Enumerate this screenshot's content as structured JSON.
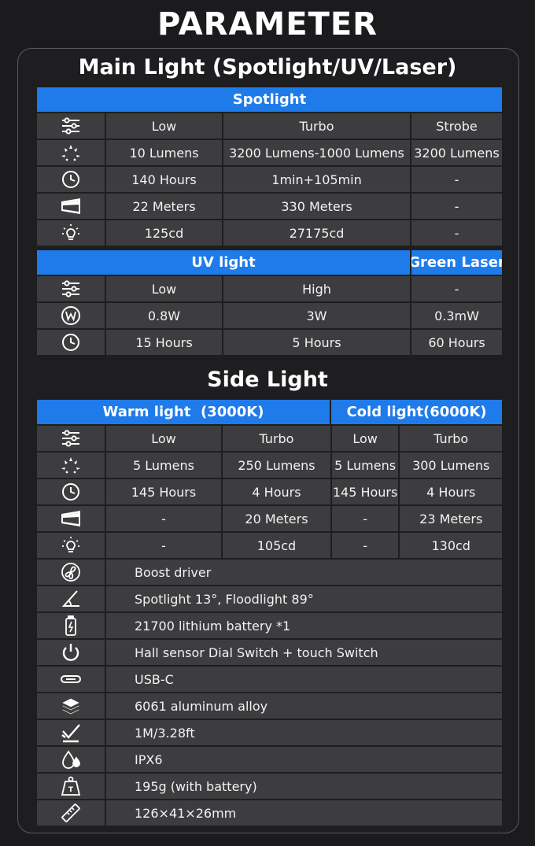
{
  "title": "PARAMETER",
  "main_light": {
    "title": "Main Light (Spotlight/UV/Laser)",
    "spotlight": {
      "header": "Spotlight",
      "rows": [
        {
          "icon": "mode-sliders-icon",
          "cells": [
            "Low",
            "Turbo",
            "Strobe"
          ]
        },
        {
          "icon": "brightness-icon",
          "cells": [
            "10 Lumens",
            "3200 Lumens-1000 Lumens",
            "3200 Lumens"
          ]
        },
        {
          "icon": "clock-icon",
          "cells": [
            "140 Hours",
            "1min+105min",
            "-"
          ]
        },
        {
          "icon": "beam-distance-icon",
          "cells": [
            "22 Meters",
            "330 Meters",
            "-"
          ]
        },
        {
          "icon": "bulb-icon",
          "cells": [
            "125cd",
            "27175cd",
            "-"
          ]
        }
      ]
    },
    "uv": {
      "header": "UV light",
      "laser_header": "Green Laser",
      "rows": [
        {
          "icon": "mode-sliders-icon",
          "cells": [
            "Low",
            "High",
            "-"
          ]
        },
        {
          "icon": "watt-icon",
          "cells": [
            "0.8W",
            "3W",
            "0.3mW"
          ]
        },
        {
          "icon": "clock-icon",
          "cells": [
            "15 Hours",
            "5 Hours",
            "60 Hours"
          ]
        }
      ]
    }
  },
  "side_light": {
    "title": "Side Light",
    "warm_header": "Warm light  (3000K)",
    "cold_header": "Cold light(6000K)",
    "rows": [
      {
        "icon": "mode-sliders-icon",
        "cells": [
          "Low",
          "Turbo",
          "Low",
          "Turbo"
        ]
      },
      {
        "icon": "brightness-icon",
        "cells": [
          "5 Lumens",
          "250 Lumens",
          "5 Lumens",
          "300 Lumens"
        ]
      },
      {
        "icon": "clock-icon",
        "cells": [
          "145 Hours",
          "4 Hours",
          "145 Hours",
          "4 Hours"
        ]
      },
      {
        "icon": "beam-distance-icon",
        "cells": [
          "-",
          "20 Meters",
          "-",
          "23 Meters"
        ]
      },
      {
        "icon": "bulb-icon",
        "cells": [
          "-",
          "105cd",
          "-",
          "130cd"
        ]
      }
    ]
  },
  "specs": [
    {
      "icon": "fan-driver-icon",
      "text": "Boost driver"
    },
    {
      "icon": "angle-icon",
      "text": "Spotlight 13°, Floodlight 89°"
    },
    {
      "icon": "battery-icon",
      "text": "21700 lithium battery *1"
    },
    {
      "icon": "power-icon",
      "text": "Hall sensor Dial Switch + touch Switch"
    },
    {
      "icon": "usb-c-icon",
      "text": "USB-C"
    },
    {
      "icon": "layers-icon",
      "text": "6061 aluminum alloy"
    },
    {
      "icon": "impact-check-icon",
      "text": "1M/3.28ft"
    },
    {
      "icon": "water-drops-icon",
      "text": "IPX6"
    },
    {
      "icon": "weight-icon",
      "text": "195g (with battery)"
    },
    {
      "icon": "ruler-icon",
      "text": "126×41×26mm"
    }
  ]
}
